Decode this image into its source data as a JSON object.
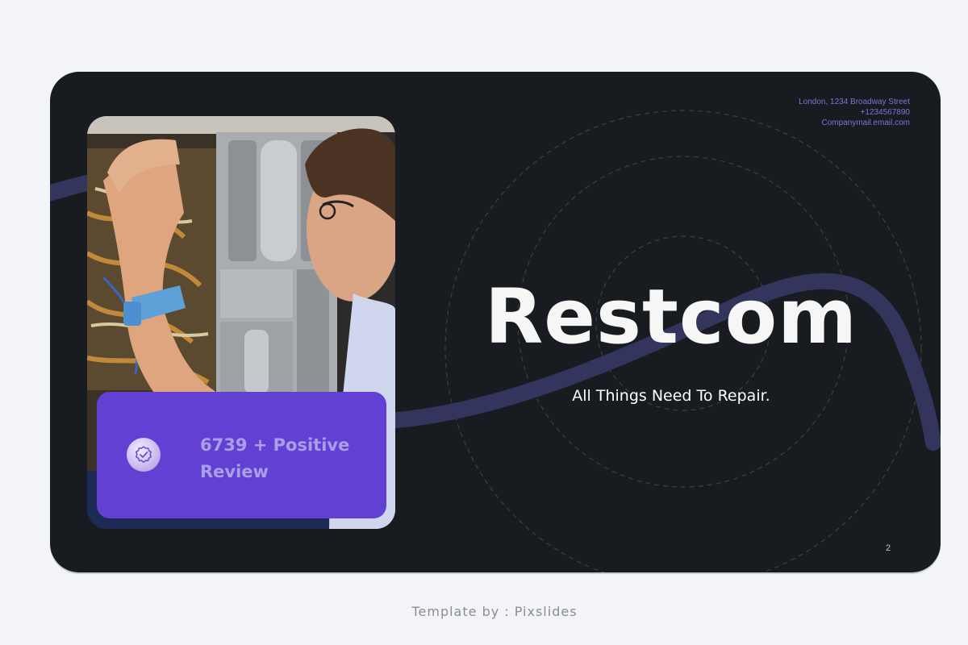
{
  "slide": {
    "contact": {
      "address": "London, 1234 Broadway Street",
      "phone": "+1234567890",
      "email": "Companymail.email.com"
    },
    "title": "Restcom",
    "subtitle": "All Things Need To Repair.",
    "review_text": "6739 + Positive Review",
    "page_number": "2"
  },
  "footer": {
    "credit": "Template by : Pixslides"
  },
  "colors": {
    "page_background": "#f3f4f8",
    "slide_background": "#181b1f",
    "accent_purple": "#6340d4",
    "wave_line": "#33355c",
    "contact_text": "#7c74d9"
  },
  "icons": {
    "review_badge": "verified-check-icon"
  }
}
